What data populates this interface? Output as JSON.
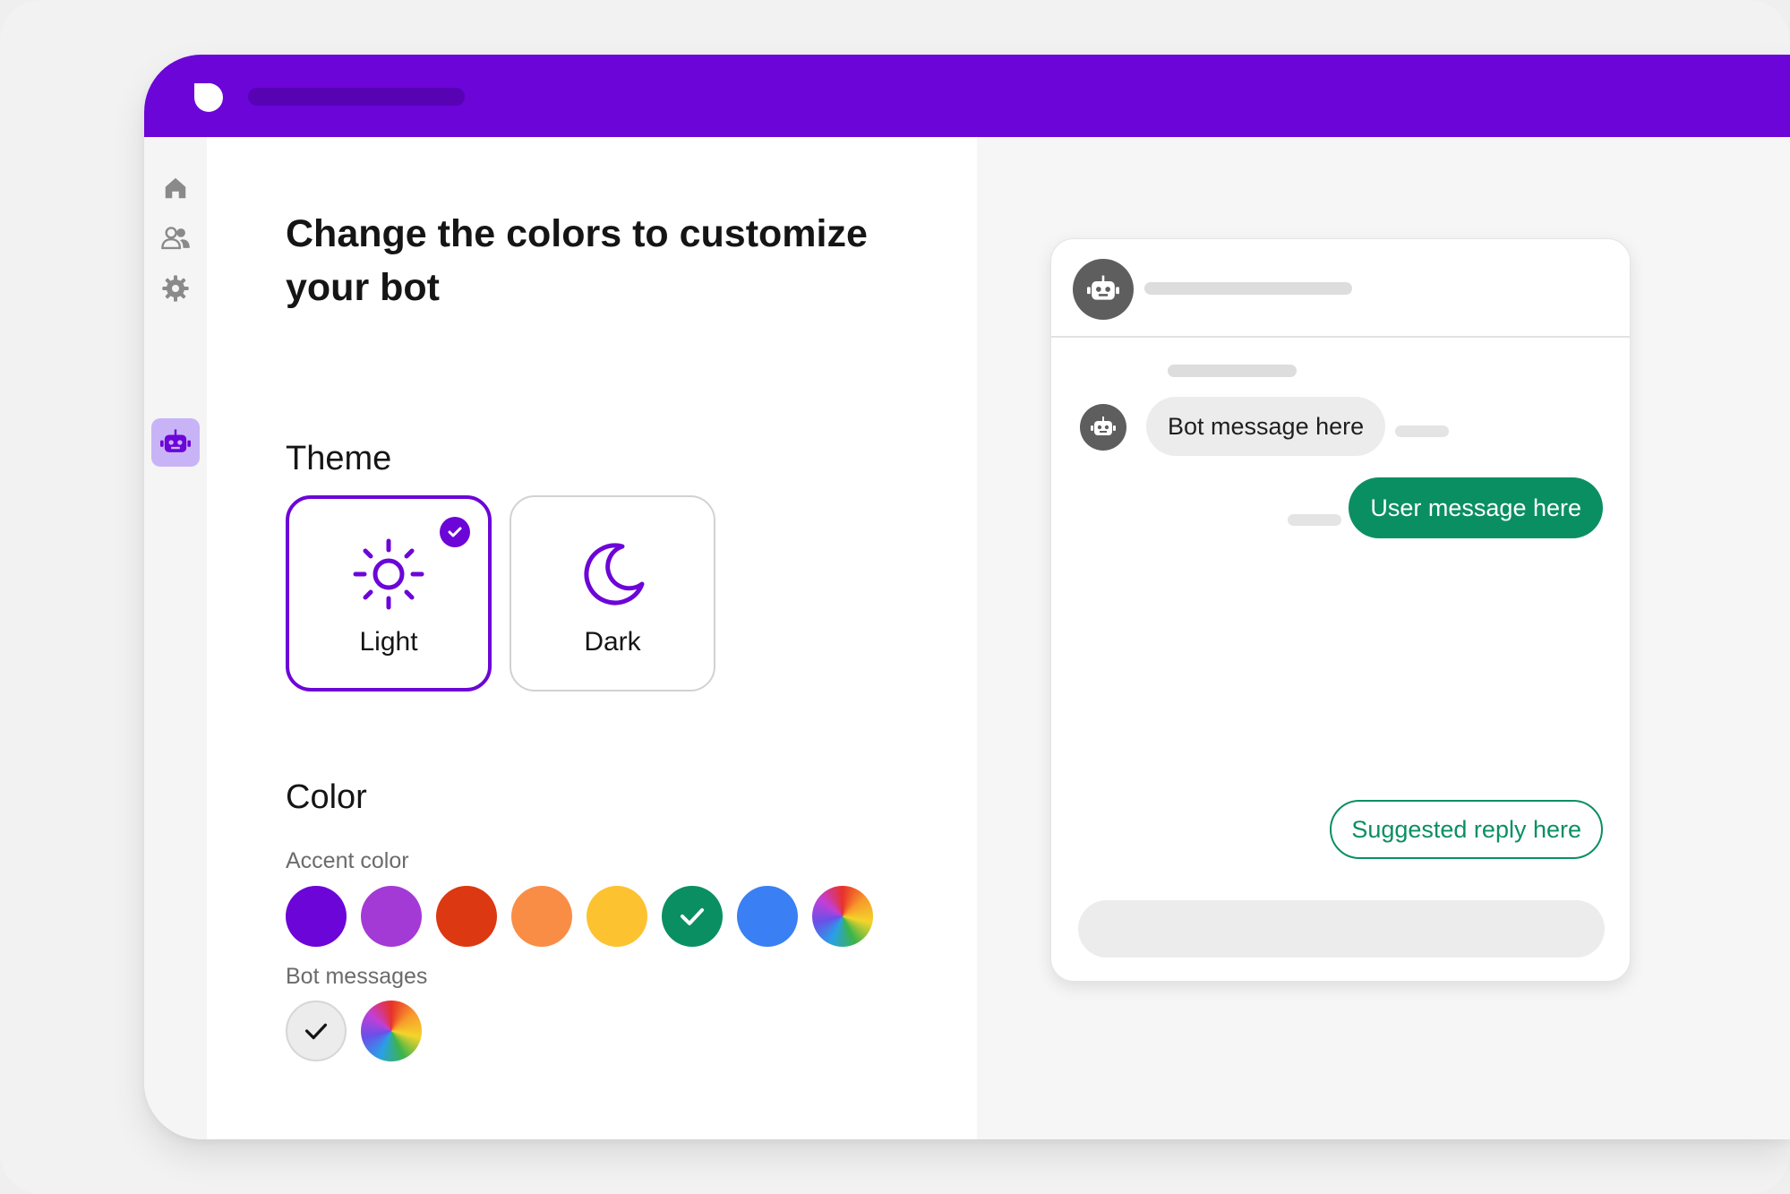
{
  "app": {
    "accent_color": "#6c05d8",
    "logo_icon": "chat-logo-icon"
  },
  "sidebar": {
    "items": [
      {
        "icon": "home-icon",
        "active": false
      },
      {
        "icon": "people-icon",
        "active": false
      },
      {
        "icon": "gear-icon",
        "active": false
      },
      {
        "icon": "robot-icon",
        "active": true
      }
    ]
  },
  "settings": {
    "heading": "Change the colors to customize your bot",
    "theme": {
      "title": "Theme",
      "options": [
        {
          "label": "Light",
          "icon": "sun-icon",
          "selected": true
        },
        {
          "label": "Dark",
          "icon": "moon-icon",
          "selected": false
        }
      ]
    },
    "color": {
      "title": "Color",
      "accent_label": "Accent color",
      "accent_swatches": [
        "#6c05d8",
        "#a43ad6",
        "#dc3812",
        "#fa8d45",
        "#fdc230",
        "#0a8f63",
        "#3a80f4",
        "rainbow"
      ],
      "accent_selected": "#0a8f63",
      "bot_messages_label": "Bot messages",
      "bot_message_swatches": [
        "#ececec",
        "rainbow"
      ],
      "bot_message_selected": "#ececec"
    }
  },
  "preview": {
    "bot_message": "Bot message here",
    "user_message": "User message here",
    "suggested_reply": "Suggested reply here",
    "user_bubble_color": "#0a8f63",
    "bot_bubble_color": "#ececec",
    "fab_icon": "chevron-down-icon"
  }
}
